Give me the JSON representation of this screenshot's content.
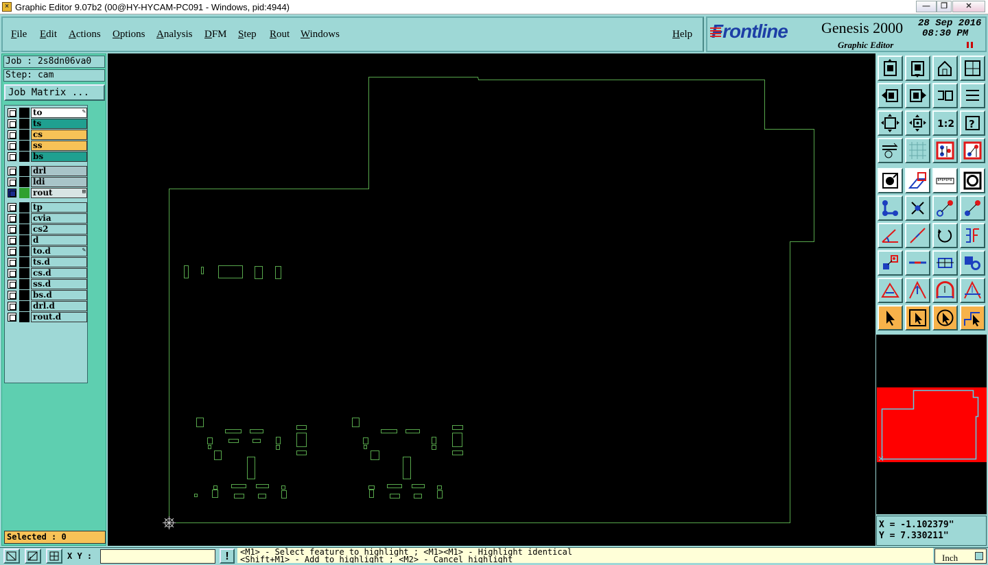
{
  "window": {
    "title": "Graphic Editor 9.07b2 (00@HY-HYCAM-PC091 - Windows, pid:4944)",
    "buttons": {
      "minimize": "—",
      "restore": "❐",
      "close": "✕"
    }
  },
  "menu": {
    "items": [
      "File",
      "Edit",
      "Actions",
      "Options",
      "Analysis",
      "DFM",
      "Step",
      "Rout",
      "Windows"
    ],
    "help": "Help"
  },
  "brand": {
    "logo": "Frontline",
    "product": "Genesis 2000",
    "subtitle": "Graphic Editor",
    "date": "28 Sep 2016",
    "time": "08:30 PM"
  },
  "job": {
    "job_label": "Job : 2s8dn06va0",
    "step_label": "Step: cam",
    "matrix_button": "Job Matrix ..."
  },
  "layers": [
    {
      "name": "to",
      "bg": "#ffffff",
      "swatch": "#000000",
      "mark": "pen"
    },
    {
      "name": "ts",
      "bg": "#20a090",
      "swatch": "#000000"
    },
    {
      "name": "cs",
      "bg": "#f7c257",
      "swatch": "#000000"
    },
    {
      "name": "ss",
      "bg": "#f7c257",
      "swatch": "#000000"
    },
    {
      "name": "bs",
      "bg": "#20a090",
      "swatch": "#000000"
    },
    {
      "name": "drl",
      "bg": "#a8c4c8",
      "swatch": "#000000"
    },
    {
      "name": "ldi",
      "bg": "#a8c4c8",
      "swatch": "#000000"
    },
    {
      "name": "rout",
      "bg": "#d8e4e4",
      "swatch": "#2fa02f",
      "mark": "grid",
      "active": true
    },
    {
      "name": "tp",
      "bg": "#9ed8d6",
      "swatch": "#000000"
    },
    {
      "name": "cvia",
      "bg": "#9ed8d6",
      "swatch": "#000000"
    },
    {
      "name": "cs2",
      "bg": "#9ed8d6",
      "swatch": "#000000"
    },
    {
      "name": "d",
      "bg": "#9ed8d6",
      "swatch": "#000000"
    },
    {
      "name": "to.d",
      "bg": "#9ed8d6",
      "swatch": "#000000",
      "mark": "pen"
    },
    {
      "name": "ts.d",
      "bg": "#9ed8d6",
      "swatch": "#000000"
    },
    {
      "name": "cs.d",
      "bg": "#9ed8d6",
      "swatch": "#000000"
    },
    {
      "name": "ss.d",
      "bg": "#9ed8d6",
      "swatch": "#000000"
    },
    {
      "name": "bs.d",
      "bg": "#9ed8d6",
      "swatch": "#000000"
    },
    {
      "name": "drl.d",
      "bg": "#9ed8d6",
      "swatch": "#000000"
    },
    {
      "name": "rout.d",
      "bg": "#9ed8d6",
      "swatch": "#000000"
    }
  ],
  "selected": "Selected : 0",
  "coords": {
    "x": "X = -1.102379\"",
    "y": "Y = 7.330211\""
  },
  "bottom": {
    "xy_label": "X Y :",
    "xy_value": "",
    "message_line1": "<M1> - Select feature to highlight ; <M1><M1> - Highlight identical",
    "message_line2": "<Shift+M1> - Add to highlight ; <M2> - Cancel highlight",
    "units": "Inch",
    "alert": "!"
  },
  "tools": [
    {
      "name": "zoom-home-icon"
    },
    {
      "name": "zoom-back-icon"
    },
    {
      "name": "home-view-icon"
    },
    {
      "name": "window-split-icon"
    },
    {
      "name": "pan-left-icon"
    },
    {
      "name": "pan-right-icon"
    },
    {
      "name": "undo-view-icon"
    },
    {
      "name": "redraw-icon"
    },
    {
      "name": "fit-all-icon"
    },
    {
      "name": "fit-center-icon"
    },
    {
      "name": "scale-1-2-icon"
    },
    {
      "name": "help-icon"
    },
    {
      "name": "tools-settings-icon"
    },
    {
      "name": "grid-icon"
    },
    {
      "name": "snap-settings-icon"
    },
    {
      "name": "snap-settings-2-icon"
    },
    {
      "name": "feature-pad-icon"
    },
    {
      "name": "measure-area-icon"
    },
    {
      "name": "ruler-icon"
    },
    {
      "name": "circle-frame-icon"
    },
    {
      "name": "connect-nodes-icon"
    },
    {
      "name": "cross-point-icon"
    },
    {
      "name": "point-to-point-icon"
    },
    {
      "name": "point-snap-icon"
    },
    {
      "name": "angle-icon"
    },
    {
      "name": "line-draw-icon"
    },
    {
      "name": "rotate-icon"
    },
    {
      "name": "mirror-icon"
    },
    {
      "name": "move-feature-icon"
    },
    {
      "name": "line-center-icon"
    },
    {
      "name": "center-measure-icon"
    },
    {
      "name": "pad-shapes-icon"
    },
    {
      "name": "triangle-measure-icon"
    },
    {
      "name": "arc-up-icon"
    },
    {
      "name": "arc-measure-icon"
    },
    {
      "name": "arc-baseline-icon"
    },
    {
      "name": "select-pointer-icon"
    },
    {
      "name": "select-box-icon"
    },
    {
      "name": "select-circle-icon"
    },
    {
      "name": "select-path-icon"
    }
  ]
}
